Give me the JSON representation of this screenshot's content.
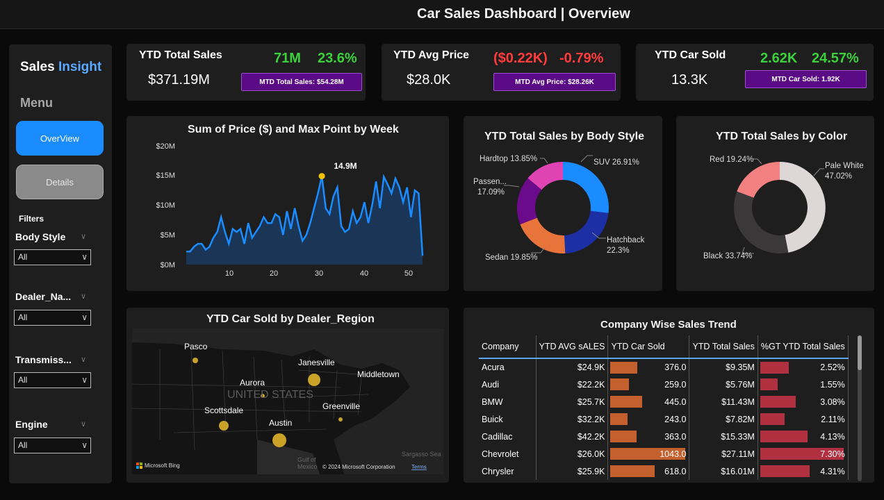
{
  "title": "Car Sales Dashboard | Overview",
  "sidebar": {
    "brand_a": "Sales",
    "brand_b": "Insight",
    "menu": "Menu",
    "overview_btn": "OverView",
    "details_btn": "Details",
    "filters_title": "Filters",
    "filters": [
      {
        "label": "Body Style",
        "value": "All"
      },
      {
        "label": "Dealer_Na...",
        "value": "All"
      },
      {
        "label": "Transmiss...",
        "value": "All"
      },
      {
        "label": "Engine",
        "value": "All"
      }
    ]
  },
  "kpis": [
    {
      "label": "YTD Total Sales",
      "value": "$371.19M",
      "delta": "71M",
      "pct": "23.6%",
      "delta_color": "#3bd13b",
      "mtd": "MTD Total Sales: $54.28M"
    },
    {
      "label": "YTD Avg Price",
      "value": "$28.0K",
      "delta": "($0.22K)",
      "pct": "-0.79%",
      "delta_color": "#ff3b3b",
      "mtd": "MTD Avg Price: $28.26K"
    },
    {
      "label": "YTD Car Sold",
      "value": "13.3K",
      "delta": "2.62K",
      "pct": "24.57%",
      "delta_color": "#3bd13b",
      "mtd": "MTD Car Sold: 1.92K"
    }
  ],
  "weekly": {
    "title": "Sum of Price ($) and Max Point by Week",
    "yticks": [
      "$20M",
      "$15M",
      "$10M",
      "$5M",
      "$0M"
    ],
    "xticks": [
      "10",
      "20",
      "30",
      "40",
      "50"
    ],
    "max_label": "14.9M",
    "color": "#1a8cff",
    "chart_data": {
      "type": "area",
      "x": [
        1,
        2,
        3,
        4,
        5,
        6,
        7,
        8,
        9,
        10,
        11,
        12,
        13,
        14,
        15,
        16,
        17,
        18,
        19,
        20,
        21,
        22,
        23,
        24,
        25,
        26,
        27,
        28,
        29,
        30,
        31,
        32,
        33,
        34,
        35,
        36,
        37,
        38,
        39,
        40,
        41,
        42,
        43,
        44,
        45,
        46,
        47,
        48,
        49,
        50,
        51,
        52,
        53
      ],
      "values": [
        2.2,
        2.2,
        3.0,
        3.5,
        3.5,
        2.5,
        3.0,
        4.5,
        5.5,
        8.0,
        5.5,
        3.5,
        6.0,
        5.5,
        6.0,
        3.5,
        7.0,
        4.5,
        5.5,
        6.5,
        8.0,
        7.0,
        7.0,
        8.5,
        8.0,
        5.0,
        9.0,
        6.0,
        9.5,
        6.5,
        4.0,
        5.0,
        7.0,
        9.5,
        12.0,
        14.9,
        9.5,
        8.5,
        11.5,
        13.0,
        6.5,
        5.5,
        6.0,
        9.0,
        7.0,
        8.0,
        10.5,
        7.0,
        10.0,
        14.0,
        9.5,
        14.8,
        13.5,
        12.0,
        14.5,
        13.0,
        10.5,
        13.0,
        8.0,
        12.5,
        12.0,
        1.5
      ],
      "ylim": [
        0,
        20
      ],
      "unit": "$M"
    }
  },
  "body_style": {
    "title": "YTD Total Sales by Body Style",
    "chart_data": {
      "type": "pie",
      "slices": [
        {
          "label": "SUV",
          "value": 26.91,
          "display": "SUV 26.91%",
          "color": "#1a8cff"
        },
        {
          "label": "Hatchback",
          "value": 22.3,
          "display_a": "Hatchback",
          "display_b": "22.3%",
          "color": "#1c2fa5"
        },
        {
          "label": "Sedan",
          "value": 19.85,
          "display": "Sedan 19.85%",
          "color": "#e8743b"
        },
        {
          "label": "Passenger",
          "value": 17.09,
          "display_a": "Passen...",
          "display_b": "17.09%",
          "color": "#6b0a8a"
        },
        {
          "label": "Hardtop",
          "value": 13.85,
          "display": "Hardtop 13.85%",
          "color": "#e044b4"
        }
      ]
    }
  },
  "color_sales": {
    "title": "YTD Total Sales by Color",
    "chart_data": {
      "type": "pie",
      "slices": [
        {
          "label": "Pale White",
          "value": 47.02,
          "display_a": "Pale White",
          "display_b": "47.02%",
          "color": "#ded7d7"
        },
        {
          "label": "Black",
          "value": 33.74,
          "display": "Black 33.74%",
          "color": "#3a3838"
        },
        {
          "label": "Red",
          "value": 19.24,
          "display": "Red 19.24%",
          "color": "#f28080"
        }
      ]
    }
  },
  "map": {
    "title": "YTD Car Sold by Dealer_Region",
    "country_label": "UNITED STATES",
    "cities": [
      "Pasco",
      "Janesville",
      "Middletown",
      "Aurora",
      "Greenville",
      "Scottsdale",
      "Austin"
    ],
    "water": [
      "Sargasso Sea",
      "Gulf of",
      "Mexico"
    ],
    "logo": "Microsoft Bing",
    "copyright": "© 2024 Microsoft Corporation",
    "terms": "Terms"
  },
  "company": {
    "title": "Company Wise Sales Trend",
    "columns": [
      "Company",
      "YTD AVG sALES",
      "YTD Car Sold",
      "YTD Total Sales",
      "%GT YTD Total Sales"
    ],
    "rows": [
      {
        "company": "Acura",
        "avg": "$24.9K",
        "sold": "376.0",
        "sold_v": 376,
        "total": "$9.35M",
        "pct": "2.52%",
        "pct_v": 2.52
      },
      {
        "company": "Audi",
        "avg": "$22.2K",
        "sold": "259.0",
        "sold_v": 259,
        "total": "$5.76M",
        "pct": "1.55%",
        "pct_v": 1.55
      },
      {
        "company": "BMW",
        "avg": "$25.7K",
        "sold": "445.0",
        "sold_v": 445,
        "total": "$11.43M",
        "pct": "3.08%",
        "pct_v": 3.08
      },
      {
        "company": "Buick",
        "avg": "$32.2K",
        "sold": "243.0",
        "sold_v": 243,
        "total": "$7.82M",
        "pct": "2.11%",
        "pct_v": 2.11
      },
      {
        "company": "Cadillac",
        "avg": "$42.2K",
        "sold": "363.0",
        "sold_v": 363,
        "total": "$15.33M",
        "pct": "4.13%",
        "pct_v": 4.13
      },
      {
        "company": "Chevrolet",
        "avg": "$26.0K",
        "sold": "1043.0",
        "sold_v": 1043,
        "total": "$27.11M",
        "pct": "7.30%",
        "pct_v": 7.3
      },
      {
        "company": "Chrysler",
        "avg": "$25.9K",
        "sold": "618.0",
        "sold_v": 618,
        "total": "$16.01M",
        "pct": "4.31%",
        "pct_v": 4.31
      }
    ],
    "sold_color": "#c4602e",
    "pct_color": "#b03040"
  }
}
